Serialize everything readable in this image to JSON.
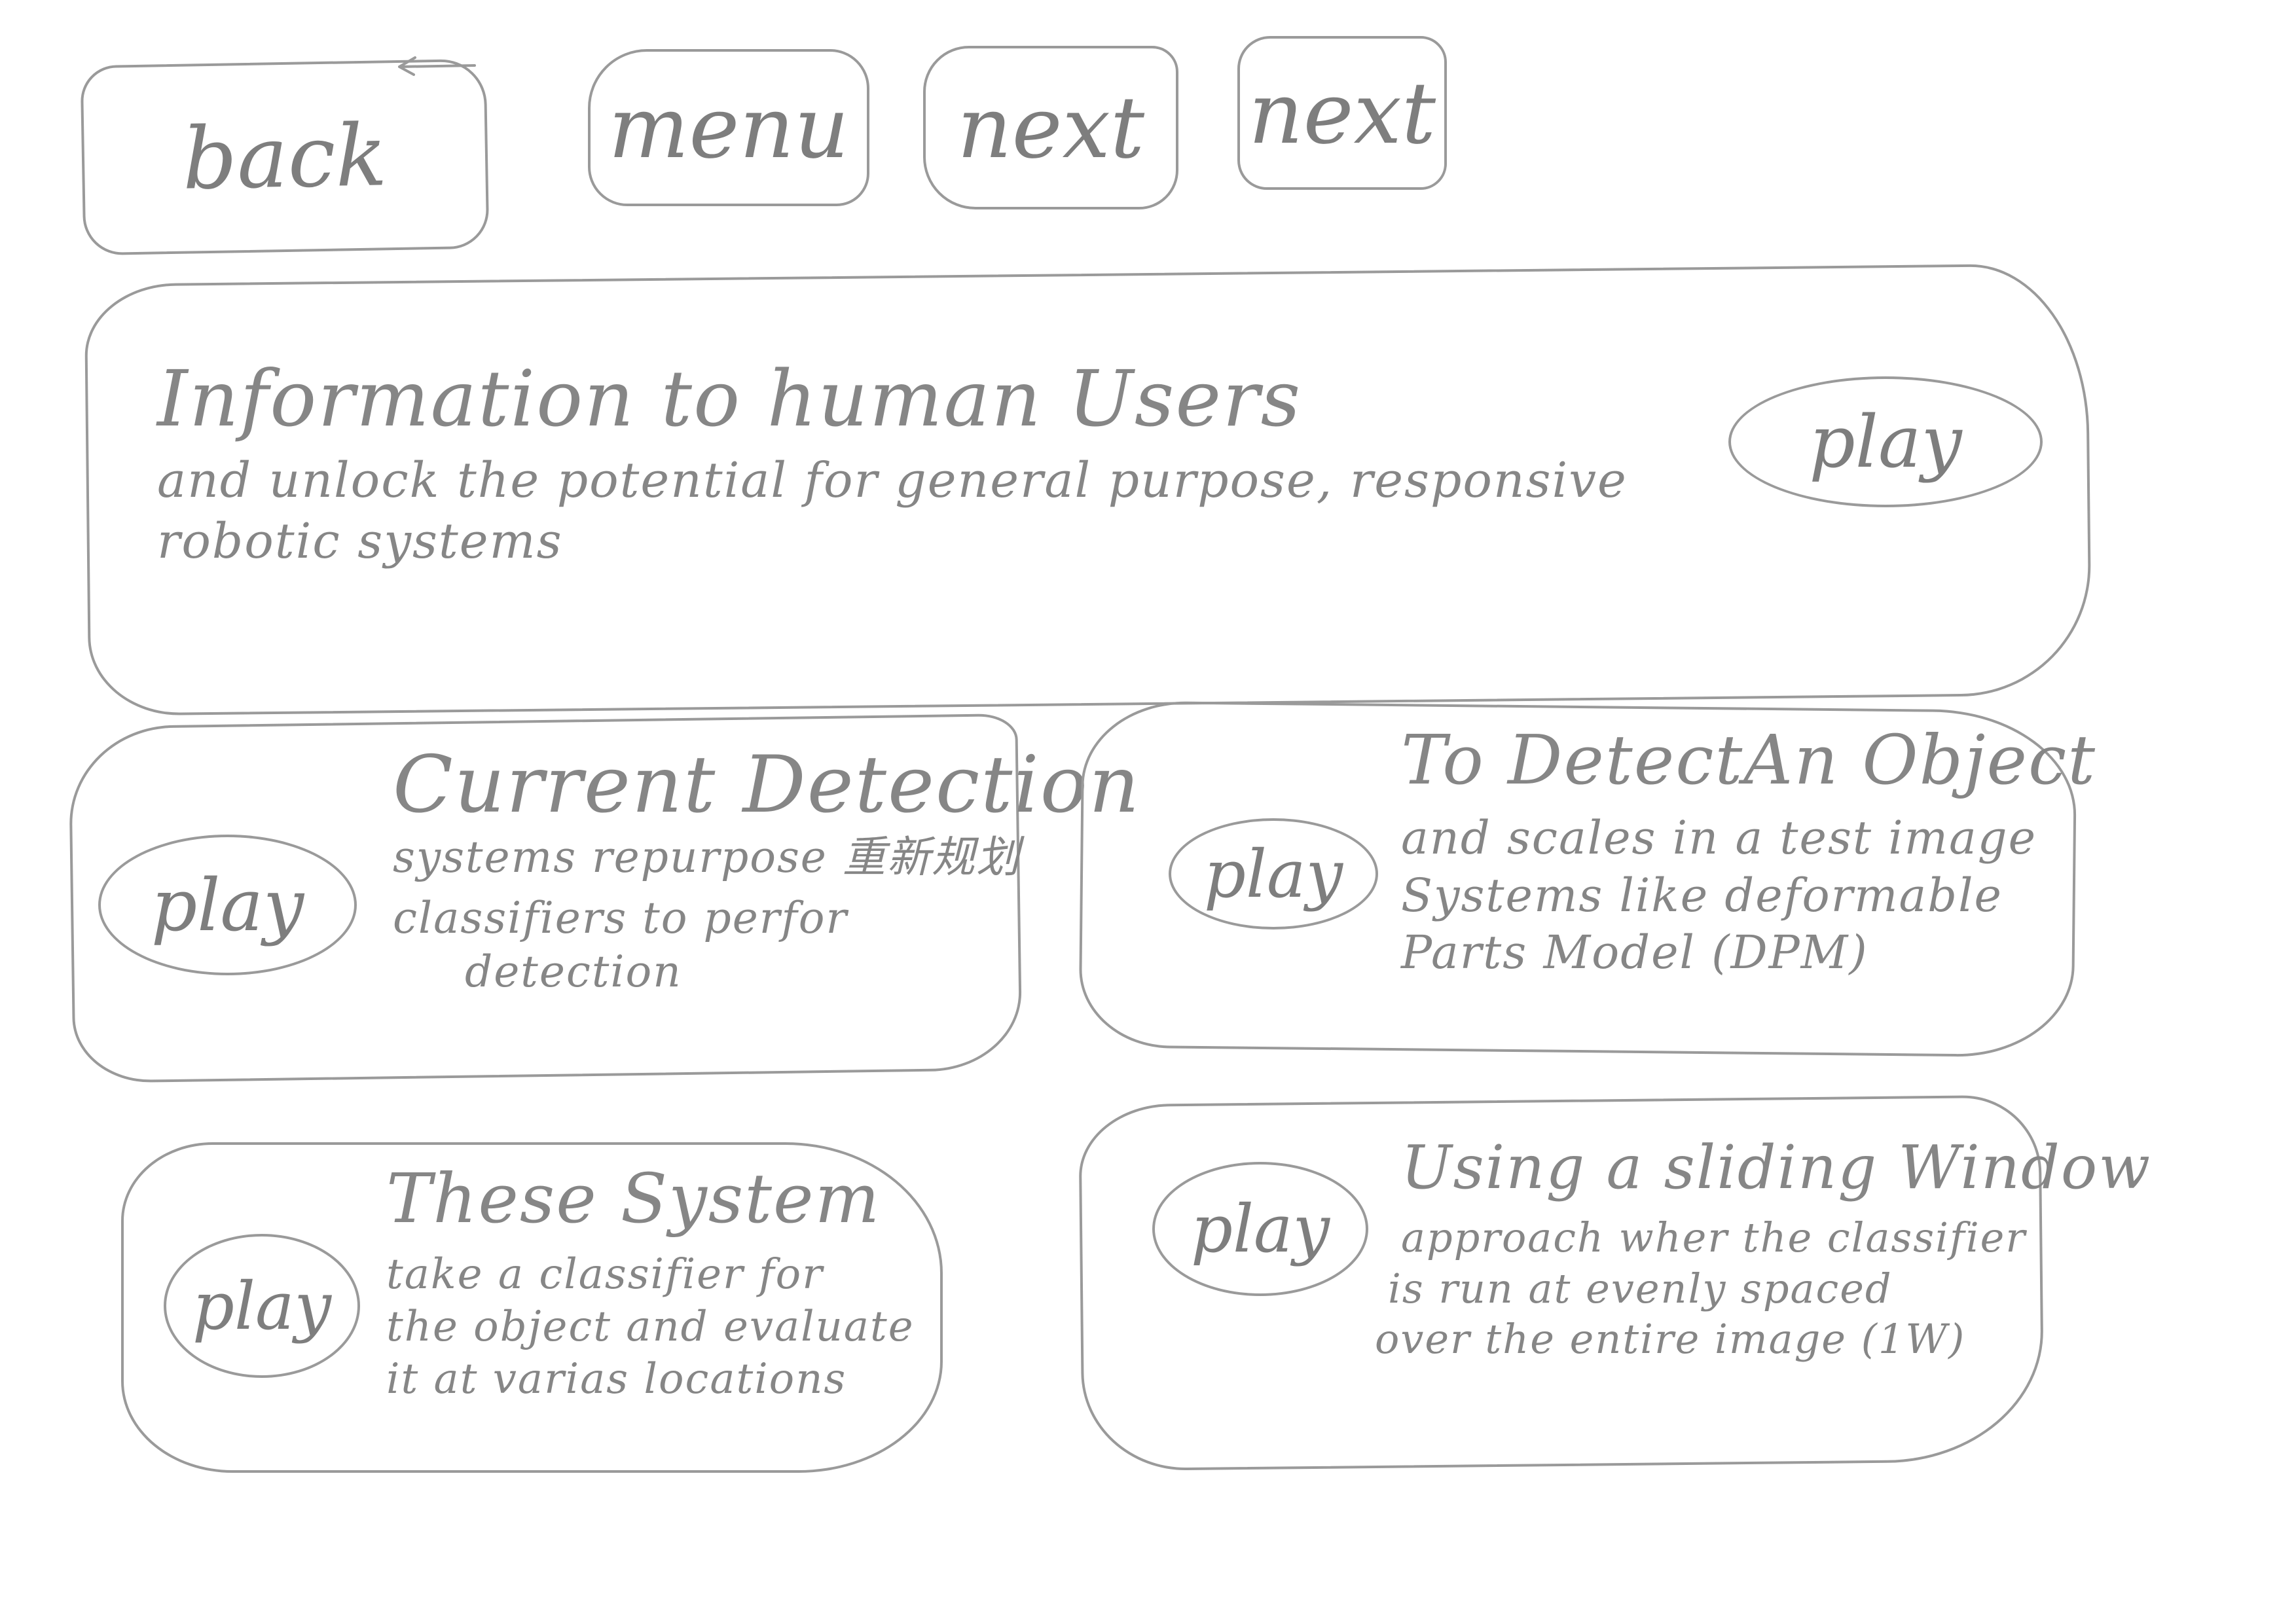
{
  "nav": {
    "back_label": "back",
    "menu_label": "menu",
    "next_label_1": "next",
    "next_label_2": "next"
  },
  "main_card": {
    "title": "Information to human Users",
    "lines": [
      "and unlock the potential for general purpose, responsive",
      "robotic systems"
    ],
    "play_label": "play"
  },
  "cards": [
    {
      "heading": "Current Detection",
      "lines": [
        "systems repurpose 重新规划",
        "classifiers to perfor",
        "detection"
      ],
      "play_label": "play"
    },
    {
      "heading": "To DetectAn Object",
      "lines": [
        "and scales in a test image",
        "Systems like deformable",
        "Parts Model (DPM)"
      ],
      "play_label": "play"
    },
    {
      "heading": "These System",
      "lines": [
        "take a classifier for",
        "the object and evaluate",
        "it at varias locations"
      ],
      "play_label": "play"
    },
    {
      "heading": "Using a sliding Window",
      "lines": [
        "approach wher the classifier",
        "is run at evenly spaced",
        "over the entire image (1W)"
      ],
      "play_label": "play"
    }
  ]
}
